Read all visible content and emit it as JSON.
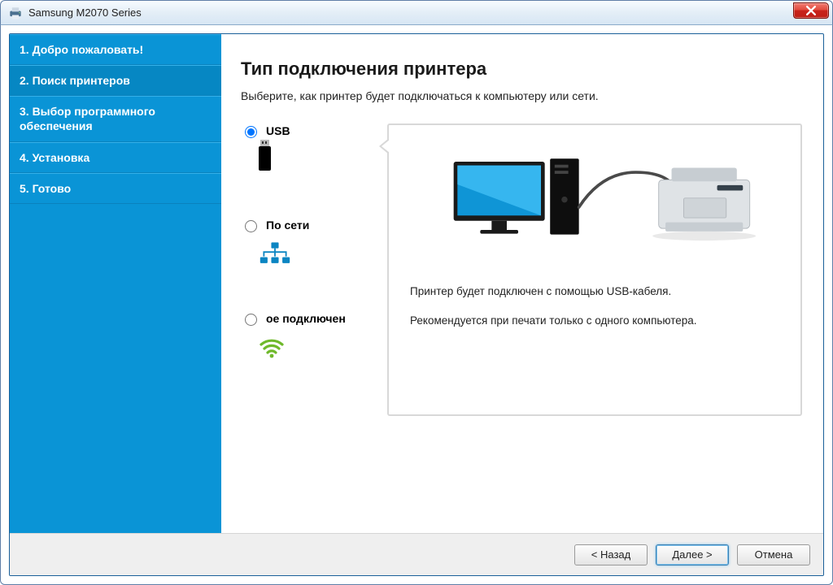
{
  "window": {
    "title": "Samsung M2070 Series",
    "close_label": "Close"
  },
  "sidebar": {
    "steps": [
      "1. Добро пожаловать!",
      "2. Поиск принтеров",
      "3. Выбор программного обеспечения",
      "4. Установка",
      "5. Готово"
    ],
    "active_index": 1
  },
  "main": {
    "heading": "Тип подключения принтера",
    "subtext": "Выберите, как принтер будет подключаться к компьютеру или сети."
  },
  "options": {
    "usb": {
      "label": "USB",
      "selected": true
    },
    "network": {
      "label": "По сети",
      "selected": false
    },
    "wireless": {
      "label": "ое подключен",
      "selected": false
    }
  },
  "panel": {
    "line1": "Принтер будет подключен с помощью USB-кабеля.",
    "line2": "Рекомендуется при печати только с одного компьютера."
  },
  "buttons": {
    "back": "< Назад",
    "next": "Далее >",
    "cancel": "Отмена"
  },
  "icons": {
    "app": "printer-icon",
    "close": "close-icon",
    "usb": "usb-stick-icon",
    "network": "network-icon",
    "wifi": "wifi-icon"
  }
}
